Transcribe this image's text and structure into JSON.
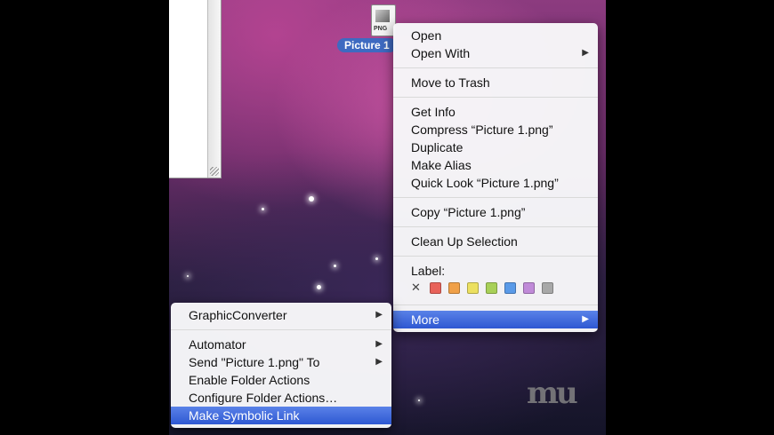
{
  "desktop_file": {
    "label": "Picture 1",
    "ext": "PNG"
  },
  "main_menu": {
    "groups": [
      [
        {
          "label": "Open",
          "submenu": false
        },
        {
          "label": "Open With",
          "submenu": true
        }
      ],
      [
        {
          "label": "Move to Trash",
          "submenu": false
        }
      ],
      [
        {
          "label": "Get Info",
          "submenu": false
        },
        {
          "label": "Compress “Picture 1.png”",
          "submenu": false
        },
        {
          "label": "Duplicate",
          "submenu": false
        },
        {
          "label": "Make Alias",
          "submenu": false
        },
        {
          "label": "Quick Look “Picture 1.png”",
          "submenu": false
        }
      ],
      [
        {
          "label": "Copy “Picture 1.png”",
          "submenu": false
        }
      ],
      [
        {
          "label": "Clean Up Selection",
          "submenu": false
        }
      ]
    ],
    "label_heading": "Label:",
    "label_colors": [
      "#e8625a",
      "#f0a048",
      "#ece060",
      "#a8d058",
      "#5a9ae8",
      "#c08ad8",
      "#a8a8a8"
    ],
    "more": {
      "label": "More",
      "submenu": true
    }
  },
  "sub_menu": {
    "groups": [
      [
        {
          "label": "GraphicConverter",
          "submenu": true
        }
      ],
      [
        {
          "label": "Automator",
          "submenu": true
        },
        {
          "label": "Send \"Picture 1.png\" To",
          "submenu": true
        },
        {
          "label": "Enable Folder Actions",
          "submenu": false
        },
        {
          "label": "Configure Folder Actions…",
          "submenu": false
        },
        {
          "label": "Make Symbolic Link",
          "submenu": false,
          "highlighted": true
        }
      ]
    ]
  },
  "watermark": "mu"
}
